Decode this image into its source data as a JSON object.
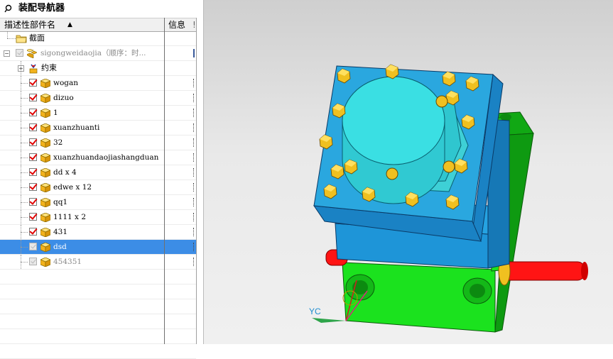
{
  "navigator": {
    "title": "装配导航器",
    "columns": {
      "name": "描述性部件名",
      "info": "信息",
      "extra": "!"
    },
    "rows": [
      {
        "label": "截面",
        "icon": "folder-icon",
        "type": "folder"
      },
      {
        "label": "sigongweidaojia（顺序：时...",
        "icon": "assembly-icon",
        "type": "assembly",
        "checked": "grey",
        "dim": true
      },
      {
        "label": "约束",
        "icon": "constraint-icon",
        "type": "constraints"
      },
      {
        "label": "wogan",
        "checked": "on"
      },
      {
        "label": "dizuo",
        "checked": "on"
      },
      {
        "label": "1",
        "checked": "on"
      },
      {
        "label": "xuanzhuanti",
        "checked": "on"
      },
      {
        "label": "32",
        "checked": "on"
      },
      {
        "label": "xuanzhuandaojiashangduan",
        "checked": "on"
      },
      {
        "label": "dd x 4",
        "checked": "on"
      },
      {
        "label": "edwe x 12",
        "checked": "on"
      },
      {
        "label": "qq1",
        "checked": "on"
      },
      {
        "label": "1111 x 2",
        "checked": "on"
      },
      {
        "label": "431",
        "checked": "on"
      },
      {
        "label": "dsd",
        "checked": "grey",
        "selected": true
      },
      {
        "label": "454351",
        "checked": "grey",
        "dim": true
      }
    ]
  },
  "viewport": {
    "axis_label": "YC"
  },
  "colors": {
    "selection": "#3c8de6",
    "top_plate": "#2aa7df",
    "cylinder": "#35d8dc",
    "base": "#19e01c",
    "shaft": "#ff1010",
    "bolt": "#f0c020"
  }
}
